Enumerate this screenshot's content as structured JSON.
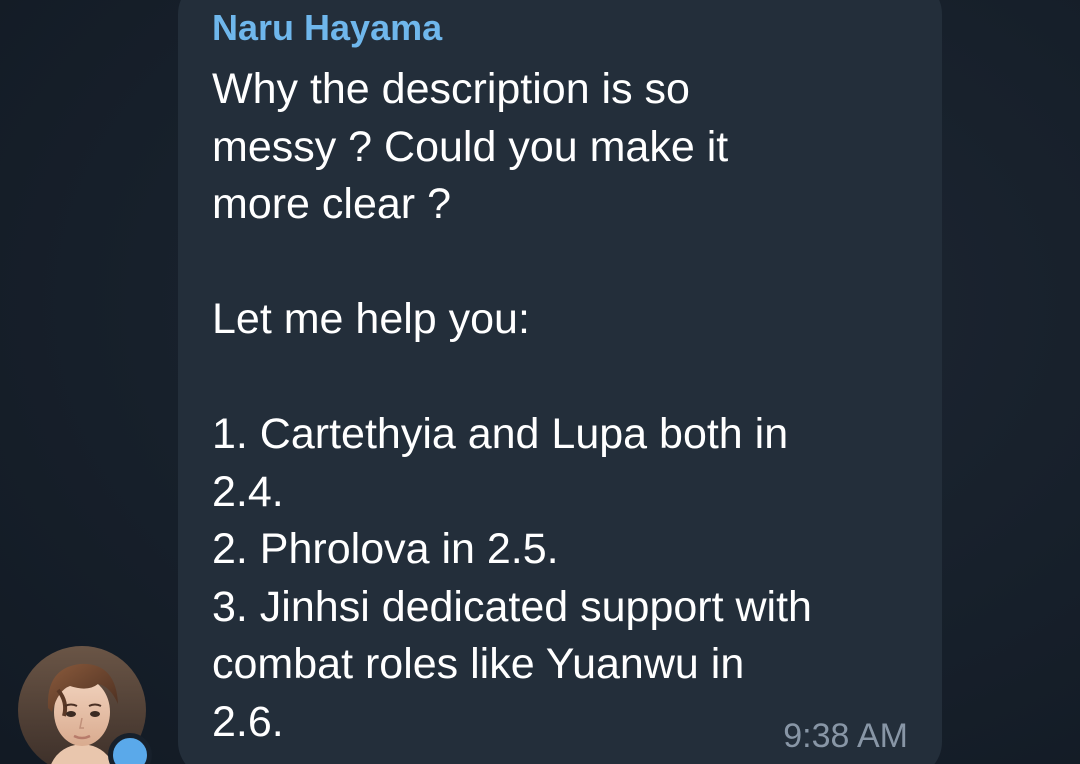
{
  "message": {
    "sender": "Naru Hayama",
    "lines": [
      "Why the description is so",
      "messy ? Could you make it",
      "more clear ?",
      "",
      "Let me help you:",
      "",
      "1. Cartethyia and Lupa both in",
      "2.4.",
      "2. Phrolova in 2.5.",
      "3. Jinhsi dedicated support with",
      "combat roles like Yuanwu in",
      "2.6."
    ],
    "timestamp": "9:38 AM"
  },
  "avatar": {
    "icon": "user-avatar-image",
    "online": true
  },
  "colors": {
    "background": "#17202b",
    "bubble": "#232e3a",
    "sender": "#6fb7ec",
    "text": "#ffffff",
    "timestamp": "#8896a6",
    "online_dot": "#5aa9ea"
  }
}
